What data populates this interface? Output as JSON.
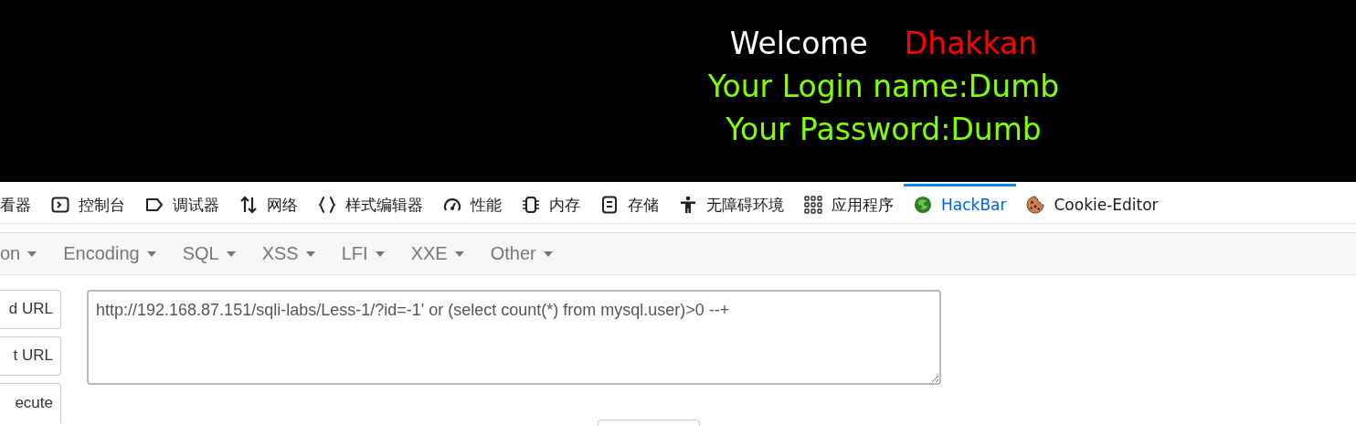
{
  "banner": {
    "welcome": "Welcome",
    "name": "Dhakkan",
    "login_line": "Your Login name:Dumb",
    "password_line": "Your Password:Dumb"
  },
  "devtools_tabs": [
    {
      "label": "看器",
      "selected": false
    },
    {
      "label": "控制台",
      "selected": false
    },
    {
      "label": "调试器",
      "selected": false
    },
    {
      "label": "网络",
      "selected": false
    },
    {
      "label": "样式编辑器",
      "selected": false
    },
    {
      "label": "性能",
      "selected": false
    },
    {
      "label": "内存",
      "selected": false
    },
    {
      "label": "存储",
      "selected": false
    },
    {
      "label": "无障碍环境",
      "selected": false
    },
    {
      "label": "应用程序",
      "selected": false
    },
    {
      "label": "HackBar",
      "selected": true
    },
    {
      "label": "Cookie-Editor",
      "selected": false
    }
  ],
  "hackbar_menu": [
    "on",
    "Encoding",
    "SQL",
    "XSS",
    "LFI",
    "XXE",
    "Other"
  ],
  "buttons": [
    "d URL",
    "t URL",
    "ecute"
  ],
  "url_field": {
    "value": "http://192.168.87.151/sqli-labs/Less-1/?id=-1' or (select count(*) from mysql.user)>0 --+"
  }
}
